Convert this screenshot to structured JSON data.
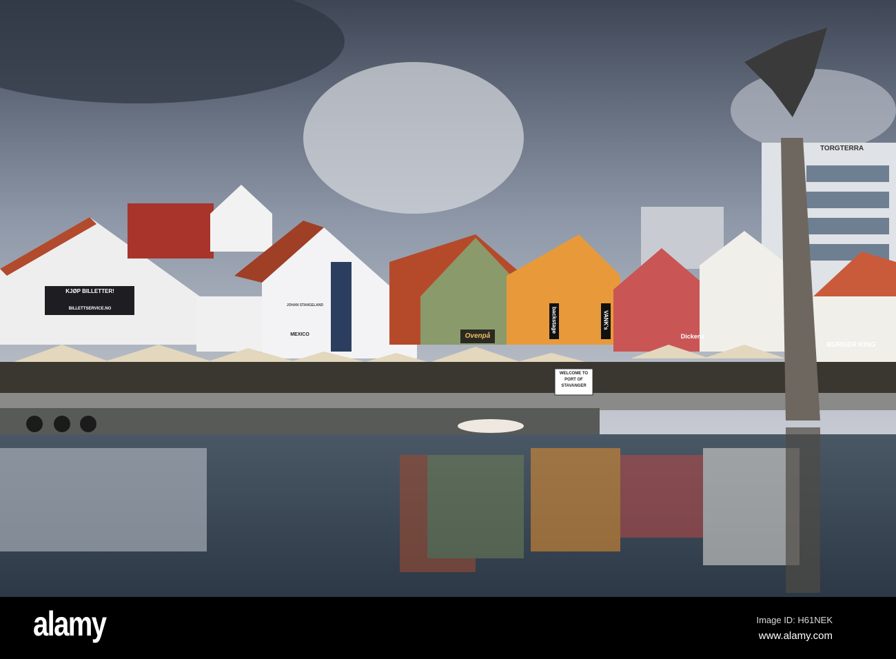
{
  "watermark": {
    "logo": "alamy",
    "image_id": "Image ID: H61NEK",
    "url": "www.alamy.com"
  },
  "signs": {
    "welcome": "WELCOME TO PORT OF STAVANGER",
    "billetter": "KJØP BILLETTER!",
    "billettservice": "BILLETTSERVICE.NO",
    "johan": "JOHAN STANGELAND",
    "mexico": "MEXICO",
    "ovenpa": "Ovenpå",
    "backstage": "backstage",
    "vanks": "VANK's",
    "dickens": "Dickens",
    "burger_king": "BURGER KING",
    "torgterrassen": "TORGTERRA"
  },
  "colors": {
    "sky": "#8a96a8",
    "water": "#3c4a5a",
    "footer": "#000000"
  }
}
